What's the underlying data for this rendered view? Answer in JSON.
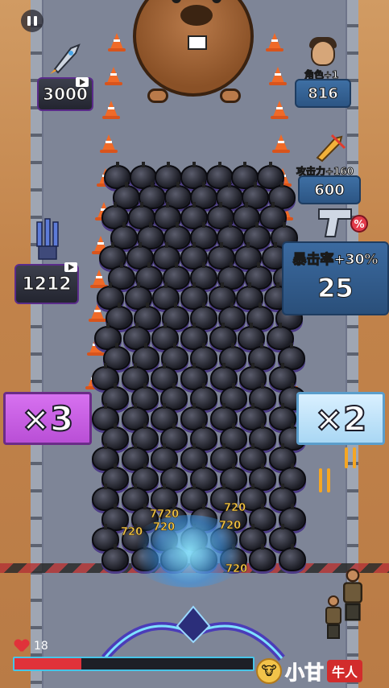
{
  "hud": {
    "pause_icon": "pause-icon",
    "hp_value": "18",
    "hp_fraction": 0.28,
    "hp_color": "#e0323a"
  },
  "gates": {
    "left_label": "×3",
    "left_color": "#c25ee0",
    "right_label": "×2",
    "right_color": "#bfe4fb"
  },
  "pickups": {
    "rocket_value": "3000",
    "rocket_icon": "rocket-icon",
    "tower_value": "1212",
    "tower_icon": "tower-icon",
    "hero_label": "角色+1",
    "hero_value": "816",
    "attack_label": "攻击力+160",
    "attack_value": "600",
    "crit_label": "暴击率+30%",
    "crit_value": "25"
  },
  "damage_numbers": [
    "7720",
    "720",
    "720",
    "720",
    "720",
    "720"
  ],
  "watermark": {
    "brand_text": "小甘",
    "brand_tag": "牛人"
  }
}
